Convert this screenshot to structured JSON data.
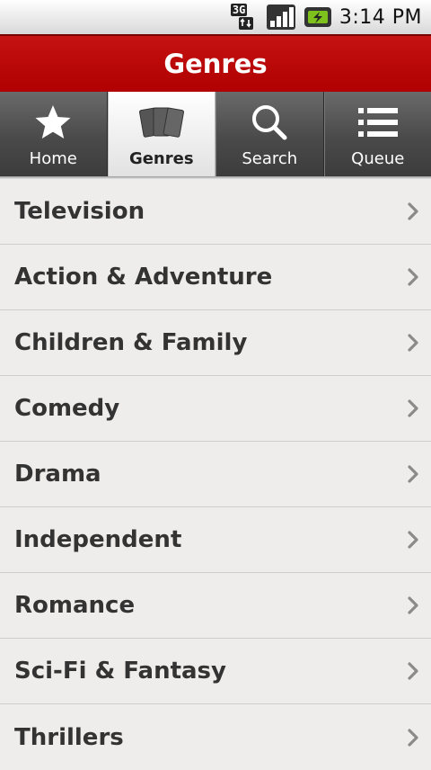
{
  "status_bar": {
    "network_label": "3G",
    "time": "3:14 PM"
  },
  "header": {
    "title": "Genres"
  },
  "tabs": [
    {
      "label": "Home",
      "icon": "star-icon",
      "active": false
    },
    {
      "label": "Genres",
      "icon": "cards-icon",
      "active": true
    },
    {
      "label": "Search",
      "icon": "search-icon",
      "active": false
    },
    {
      "label": "Queue",
      "icon": "list-icon",
      "active": false
    }
  ],
  "genres": [
    {
      "label": "Television"
    },
    {
      "label": "Action & Adventure"
    },
    {
      "label": "Children & Family"
    },
    {
      "label": "Comedy"
    },
    {
      "label": "Drama"
    },
    {
      "label": "Independent"
    },
    {
      "label": "Romance"
    },
    {
      "label": "Sci-Fi & Fantasy"
    },
    {
      "label": "Thrillers"
    }
  ],
  "colors": {
    "title_bar": "#b80000",
    "list_background": "#efedeb",
    "list_text": "#333333",
    "battery_accent": "#7ec11d"
  }
}
